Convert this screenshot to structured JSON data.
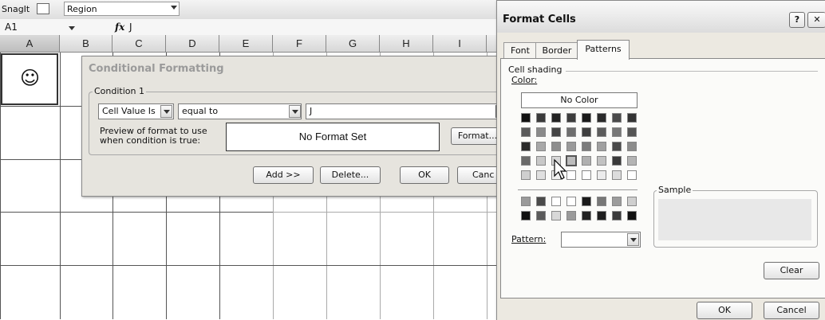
{
  "toolbar": {
    "snagit_label": "SnagIt",
    "region_label": "Region"
  },
  "formula_bar": {
    "cell_ref": "A1",
    "fx": "fx",
    "value": "J"
  },
  "columns": [
    "A",
    "B",
    "C",
    "D",
    "E",
    "F",
    "G",
    "H",
    "I"
  ],
  "cell_a1": {
    "symbol": "☺"
  },
  "conditional_formatting": {
    "title": "Conditional Formatting",
    "condition_label": "Condition 1",
    "value_type": "Cell Value Is",
    "operator": "equal to",
    "value": "J",
    "preview_label_line1": "Preview of format to use",
    "preview_label_line2": "when condition is true:",
    "preview_text": "No Format Set",
    "format_button": "Format...",
    "add_button": "Add >>",
    "delete_button": "Delete...",
    "ok_button": "OK",
    "cancel_button": "Canc"
  },
  "format_cells": {
    "title": "Format Cells",
    "help_button": "?",
    "close_button": "✕",
    "tabs": [
      "Font",
      "Border",
      "Patterns"
    ],
    "active_tab": "Patterns",
    "cell_shading_label": "Cell shading",
    "color_label": "Color:",
    "no_color_button": "No Color",
    "pattern_label": "Pattern:",
    "sample_label": "Sample",
    "clear_button": "Clear",
    "ok_button": "OK",
    "cancel_button": "Cancel",
    "palette_colors": [
      [
        "#111111",
        "#3a3a3a",
        "#222222",
        "#3c3c3c",
        "#1a1a1a",
        "#2a2a2a",
        "#4a4a4a",
        "#333333"
      ],
      [
        "#5a5a5a",
        "#8a8a8a",
        "#444444",
        "#6e6e6e",
        "#3f3f3f",
        "#5c5c5c",
        "#777777",
        "#555555"
      ],
      [
        "#2a2a2a",
        "#a8a8a8",
        "#8e8e8e",
        "#9a9a9a",
        "#7c7c7c",
        "#a0a0a0",
        "#4a4a4a",
        "#8c8c8c"
      ],
      [
        "#6a6a6a",
        "#c8c8c8",
        "#d8d8d8",
        "#bcbcbc",
        "#b0b0b0",
        "#c2c2c2",
        "#3a3a3a",
        "#b4b4b4"
      ],
      [
        "#cfcfcf",
        "#e0e0e0",
        "#f0f0f0",
        "#ffffff",
        "#ffffff",
        "#ececec",
        "#dcdcdc",
        "#ffffff"
      ]
    ],
    "palette_colors_2": [
      [
        "#9a9a9a",
        "#4a4a4a",
        "#ffffff",
        "#ffffff",
        "#1a1a1a",
        "#777777",
        "#9c9c9c",
        "#cfcfcf"
      ],
      [
        "#111111",
        "#5a5a5a",
        "#d8d8d8",
        "#9a9a9a",
        "#222222",
        "#1e1e1e",
        "#3a3a3a",
        "#111111"
      ]
    ]
  }
}
